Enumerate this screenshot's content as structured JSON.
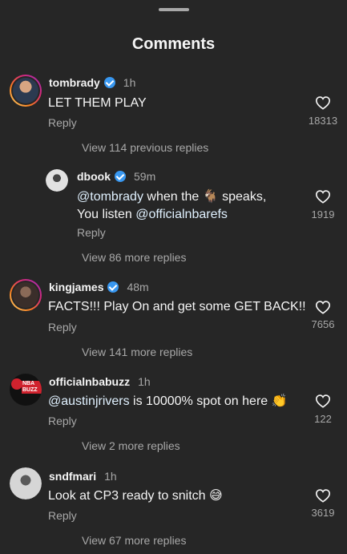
{
  "header": {
    "title": "Comments"
  },
  "comments": [
    {
      "username": "tombrady",
      "time": "1h",
      "text": "LET THEM PLAY",
      "reply": "Reply",
      "likes": "18313",
      "view_more": "View 114 previous replies"
    },
    {
      "username": "dbook",
      "time": "59m",
      "mention1": "@tombrady",
      "text_a": " when the ",
      "emoji": "🐐",
      "text_b": " speaks,",
      "text_c": "You listen ",
      "mention2": "@officialnbarefs",
      "reply": "Reply",
      "likes": "1919",
      "view_more": "View 86 more replies"
    },
    {
      "username": "kingjames",
      "time": "48m",
      "text": "FACTS!!! Play On and get some GET BACK!!",
      "reply": "Reply",
      "likes": "7656",
      "view_more": "View 141 more replies"
    },
    {
      "username": "officialnbabuzz",
      "time": "1h",
      "mention": "@austinjrivers",
      "text": " is 10000% spot on here ",
      "emoji": "👏",
      "reply": "Reply",
      "likes": "122",
      "view_more": "View 2 more replies"
    },
    {
      "username": "sndfmari",
      "time": "1h",
      "text": "Look at CP3 ready to snitch ",
      "emoji": "😅",
      "reply": "Reply",
      "likes": "3619",
      "view_more": "View 67 more replies"
    }
  ],
  "avatars": {
    "tombrady_bg": "#3a5a7a",
    "dbook_bg": "#d8d8d8",
    "kingjames_bg": "#6a4a3a",
    "officialnbabuzz_label": "NBA BUZZ",
    "sndfmari_bg": "#cfcfcf"
  }
}
